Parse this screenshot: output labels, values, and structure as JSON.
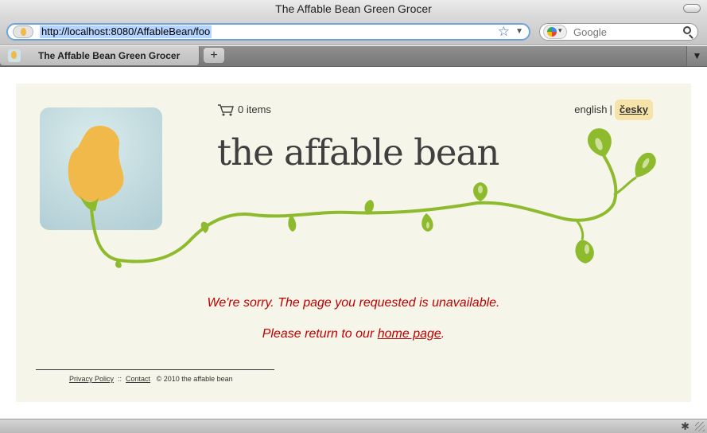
{
  "window": {
    "title": "The Affable Bean Green Grocer"
  },
  "navbar": {
    "url": "http://localhost:8080/AffableBean/foo",
    "search_placeholder": "Google",
    "icons": {
      "bookmark": "star-icon",
      "url_dropdown": "chevron-down-icon",
      "search_engine": "google-icon",
      "search": "search-icon"
    }
  },
  "tabs": [
    {
      "label": "The Affable Bean Green Grocer",
      "active": true
    }
  ],
  "newtab_label": "+",
  "page": {
    "cart_count": "0 items",
    "lang_english": "english",
    "lang_sep": "|",
    "lang_cesky": "česky",
    "logo_text": "the affable bean",
    "error_message": "We're sorry. The page you requested is unavailable.",
    "return_prefix": "Please return to our",
    "return_link": "home page",
    "return_suffix": ".",
    "footer": {
      "privacy": "Privacy Policy",
      "sep": "::",
      "contact": "Contact",
      "copyright": "©  2010 the affable bean"
    }
  },
  "colors": {
    "page_bg": "#f5f5e9",
    "error_text": "#c00000",
    "vine": "#8dbb2d",
    "bean": "#f1b94a",
    "highlight_lang": "#f6e3a8"
  }
}
